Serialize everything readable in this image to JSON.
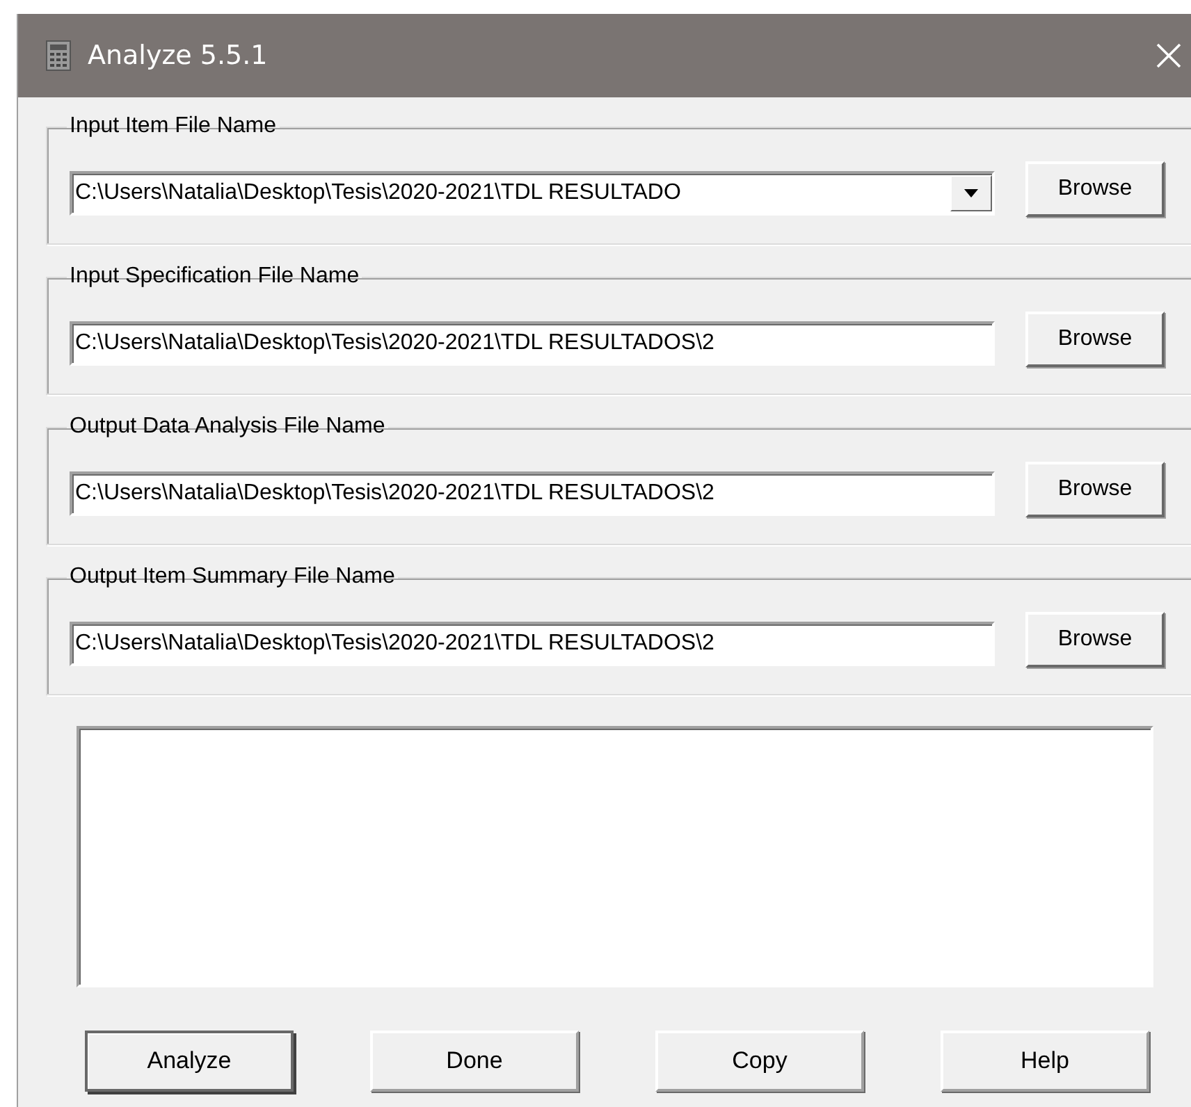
{
  "window": {
    "title": "Analyze 5.5.1"
  },
  "file_groups": [
    {
      "label": "Input Item File Name",
      "kind": "combo",
      "value": "C:\\Users\\Natalia\\Desktop\\Tesis\\2020-2021\\TDL RESULTADO",
      "button": "Browse"
    },
    {
      "label": "Input Specification File Name",
      "kind": "text",
      "value": "C:\\Users\\Natalia\\Desktop\\Tesis\\2020-2021\\TDL RESULTADOS\\2",
      "button": "Browse"
    },
    {
      "label": "Output Data Analysis File Name",
      "kind": "text",
      "value": "C:\\Users\\Natalia\\Desktop\\Tesis\\2020-2021\\TDL RESULTADOS\\2",
      "button": "Browse"
    },
    {
      "label": "Output Item Summary File Name",
      "kind": "text",
      "value": "C:\\Users\\Natalia\\Desktop\\Tesis\\2020-2021\\TDL RESULTADOS\\2",
      "button": "Browse"
    }
  ],
  "buttons": [
    {
      "label": "Analyze",
      "default": true
    },
    {
      "label": "Done",
      "default": false
    },
    {
      "label": "Copy",
      "default": false
    },
    {
      "label": "Help",
      "default": false
    }
  ]
}
